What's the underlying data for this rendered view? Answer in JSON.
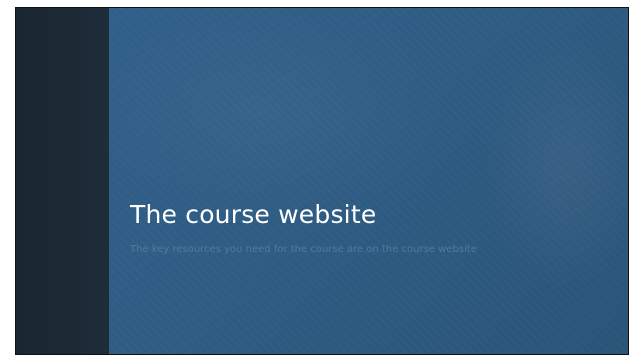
{
  "slide": {
    "title": "The course website",
    "subtitle": "The key resources you need for the course are on the course website"
  },
  "colors": {
    "side_band": "#1c2a36",
    "main_background": "#2f5c84",
    "title_text": "#ffffff",
    "subtitle_text": "#4f7a9c"
  }
}
